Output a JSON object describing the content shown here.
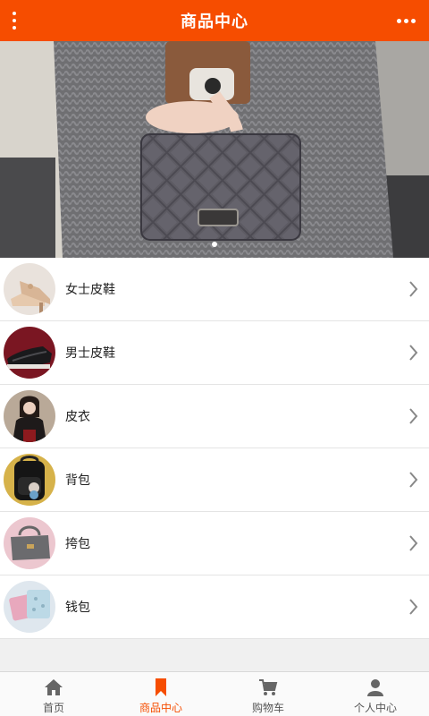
{
  "header": {
    "title": "商品中心",
    "menu_icon": "vertical-dots-icon",
    "more_icon": "horizontal-dots-icon"
  },
  "banner": {
    "slides": 1,
    "active_slide": 1,
    "image": "handbag-photo"
  },
  "categories": [
    {
      "label": "女士皮鞋",
      "icon": "womens-shoes-thumb"
    },
    {
      "label": "男士皮鞋",
      "icon": "mens-shoes-thumb"
    },
    {
      "label": "皮衣",
      "icon": "leather-jacket-thumb"
    },
    {
      "label": "背包",
      "icon": "backpack-thumb"
    },
    {
      "label": "挎包",
      "icon": "shoulder-bag-thumb"
    },
    {
      "label": "钱包",
      "icon": "wallet-thumb"
    }
  ],
  "tabbar": {
    "tabs": [
      {
        "label": "首页",
        "icon": "home-icon",
        "active": false
      },
      {
        "label": "商品中心",
        "icon": "bookmark-icon",
        "active": true
      },
      {
        "label": "购物车",
        "icon": "cart-icon",
        "active": false
      },
      {
        "label": "个人中心",
        "icon": "user-icon",
        "active": false
      }
    ]
  },
  "colors": {
    "accent": "#f64d00",
    "tab_inactive": "#666666"
  }
}
